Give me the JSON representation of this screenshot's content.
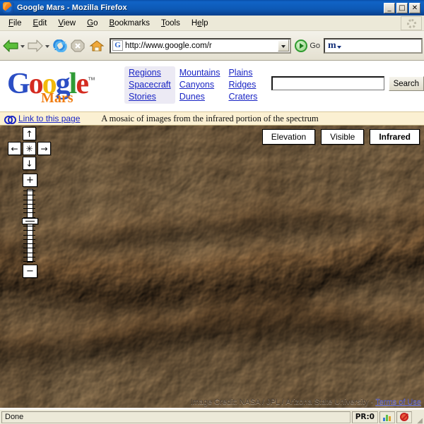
{
  "window": {
    "title": "Google Mars - Mozilla Firefox",
    "icon": "firefox-icon",
    "minimize_label": "_",
    "maximize_label": "□",
    "close_label": "✕"
  },
  "menubar": {
    "items": [
      {
        "label": "File",
        "accel": "F"
      },
      {
        "label": "Edit",
        "accel": "E"
      },
      {
        "label": "View",
        "accel": "V"
      },
      {
        "label": "Go",
        "accel": "G"
      },
      {
        "label": "Bookmarks",
        "accel": "B"
      },
      {
        "label": "Tools",
        "accel": "T"
      },
      {
        "label": "Help",
        "accel": "H"
      }
    ],
    "throbber": "throbber-icon"
  },
  "toolbar": {
    "back": "back-arrow-icon",
    "forward": "forward-arrow-icon",
    "reload": "reload-icon",
    "stop": "stop-icon",
    "home": "home-icon",
    "url_value": "http://www.google.com/r",
    "url_placeholder": "",
    "favicon_letter": "G",
    "go_label": "Go",
    "search_value": "m",
    "search_placeholder": ""
  },
  "site": {
    "logo": {
      "letters": [
        "G",
        "o",
        "o",
        "g",
        "l",
        "e"
      ],
      "tm": "™",
      "subtitle": "Mars"
    },
    "nav_primary": [
      "Regions",
      "Spacecraft",
      "Stories"
    ],
    "nav_secondary": [
      "Mountains",
      "Canyons",
      "Dunes"
    ],
    "nav_tertiary": [
      "Plains",
      "Ridges",
      "Craters"
    ],
    "search_value": "",
    "search_placeholder": "",
    "search_button": "Search"
  },
  "linkbar": {
    "chain_icon": "chain-link-icon",
    "link_label": "Link to this page",
    "caption": "A mosaic of images from the infrared portion of the spectrum"
  },
  "map": {
    "modes": [
      {
        "label": "Elevation",
        "active": false
      },
      {
        "label": "Visible",
        "active": false
      },
      {
        "label": "Infrared",
        "active": true
      }
    ],
    "pan": {
      "up": "↑",
      "left": "←",
      "right": "→",
      "down": "↓",
      "center": "✳"
    },
    "zoom": {
      "in": "+",
      "out": "−",
      "level_percent": 45,
      "tick_count": 17
    },
    "credit_text": "Image Credit: NASA / JPL / Arizona State University - ",
    "credit_link": "Terms of Use"
  },
  "statusbar": {
    "message": "Done",
    "pagerank": "PR:0",
    "chart_icon": "bar-chart-icon",
    "block_icon": "no-entry-icon",
    "resize_grip": "resize-grip-icon"
  },
  "colors": {
    "titlebar": "#0d58b4",
    "chrome": "#ece9d8",
    "link": "#1a25c4",
    "linkbar_bg": "#fbf0d2",
    "mars_base": "#9a7145",
    "mars_light": "#d9bb8d"
  }
}
